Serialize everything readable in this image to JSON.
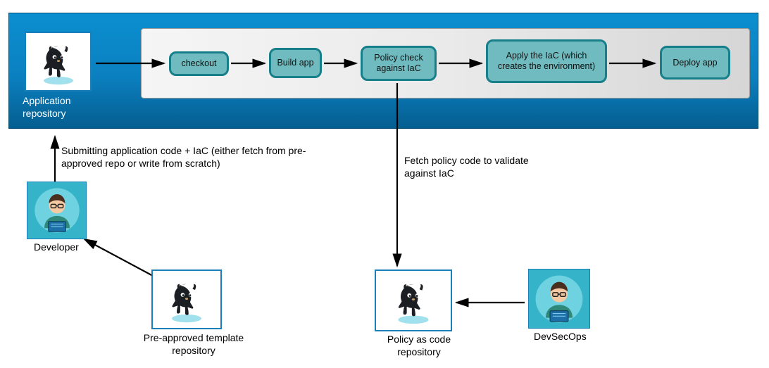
{
  "labels": {
    "app_repo": "Application repository",
    "policy_repo": "Policy as code repository",
    "template_repo": "Pre-approved template repository",
    "developer": "Developer",
    "devsecops": "DevSecOps",
    "submit_text": "Submitting application code + IaC (either fetch from pre-approved repo or write from scratch)",
    "fetch_policy": "Fetch policy code to validate against IaC"
  },
  "pipeline": {
    "checkout": "checkout",
    "build": "Build app",
    "policy_check": "Policy check against IaC",
    "apply_iac": "Apply the IaC (which creates the environment)",
    "deploy": "Deploy app"
  },
  "colors": {
    "band_top": "#0b8fd0",
    "band_bottom": "#055e90",
    "node_fill": "#6fbbbf",
    "node_border": "#177f8a",
    "avatar_bg": "#35b3c9"
  }
}
